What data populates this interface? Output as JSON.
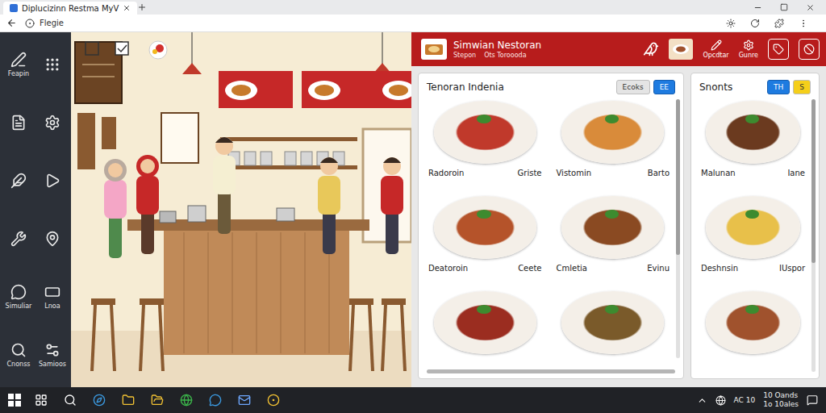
{
  "browser": {
    "tab_title": "Diplucizinn Restma MyV",
    "address": "Flegie"
  },
  "sidebar": {
    "items": [
      {
        "label": "Feapin"
      },
      {
        "label": "Simuliar"
      },
      {
        "label": "Lnoa"
      },
      {
        "label": "Cnonss"
      },
      {
        "label": "Samioos"
      }
    ]
  },
  "app_header": {
    "title": "Simwian Nestoran",
    "subtitle": "Stepon",
    "subtitle_right": "Ots Toroooda",
    "actions": [
      {
        "label": "Opcdtar"
      },
      {
        "label": "Gunre"
      }
    ]
  },
  "cards": [
    {
      "title": "Tenoran Indenia",
      "chips": [
        {
          "label": "Ecoks",
          "selected": false,
          "color": "#e4e4e4"
        },
        {
          "label": "EE",
          "selected": true,
          "color": "#1e7be0"
        }
      ],
      "items": [
        {
          "name": "Radoroin",
          "tag": "Griste",
          "color": "#c0392b"
        },
        {
          "name": "Vistomin",
          "tag": "Barto",
          "color": "#d98b3a"
        },
        {
          "name": "Deatoroin",
          "tag": "Ceete",
          "color": "#b5532a"
        },
        {
          "name": "Cmletia",
          "tag": "Evinu",
          "color": "#8a4a22"
        },
        {
          "color": "#9b2d20"
        },
        {
          "color": "#7a5a2a"
        }
      ]
    },
    {
      "title": "Snonts",
      "chips": [
        {
          "label": "TH",
          "selected": true,
          "color": "#1e7be0"
        },
        {
          "label": "S",
          "selected": false,
          "color": "#f5cf1a"
        }
      ],
      "items": [
        {
          "name": "Malunan",
          "tag": "Iane",
          "color": "#6b3a1f"
        },
        {
          "name": "Deshnsin",
          "tag": "IUspor",
          "color": "#e8c04a"
        },
        {
          "color": "#a0522d"
        }
      ]
    }
  ],
  "taskbar": {
    "tray": "AC 10",
    "clock": [
      "10 Oands",
      "1o 10ales"
    ]
  }
}
